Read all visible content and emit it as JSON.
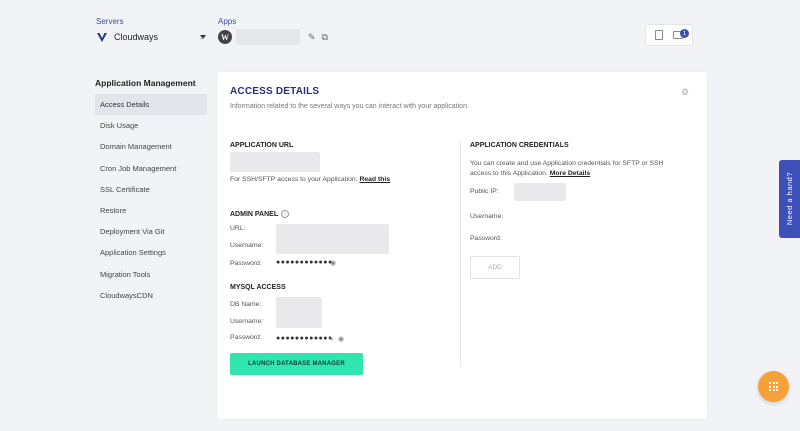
{
  "header": {
    "servers_label": "Servers",
    "server_name": "Cloudways",
    "apps_label": "Apps",
    "notification_count": "1"
  },
  "sidebar": {
    "title": "Application Management",
    "items": [
      {
        "label": "Access Details",
        "active": true
      },
      {
        "label": "Disk Usage"
      },
      {
        "label": "Domain Management"
      },
      {
        "label": "Cron Job Management"
      },
      {
        "label": "SSL Certificate"
      },
      {
        "label": "Restore"
      },
      {
        "label": "Deployment Via Git"
      },
      {
        "label": "Application Settings"
      },
      {
        "label": "Migration Tools"
      },
      {
        "label": "CloudwaysCDN"
      }
    ]
  },
  "card": {
    "title": "ACCESS DETAILS",
    "subtitle": "Information related to the several ways you can interact with your application.",
    "app_url": {
      "heading": "APPLICATION URL",
      "sftp_note": "For SSH/SFTP access to your Application.",
      "read_link": "Read this"
    },
    "admin_panel": {
      "heading": "ADMIN PANEL",
      "url_label": "URL:",
      "username_label": "Username:",
      "password_label": "Password:",
      "password_mask": "●●●●●●●●●●●●"
    },
    "mysql": {
      "heading": "MYSQL ACCESS",
      "db_label": "DB Name:",
      "username_label": "Username:",
      "password_label": "Password:",
      "password_mask": "●●●●●●●●●●●●",
      "launch_button": "LAUNCH DATABASE MANAGER"
    },
    "credentials": {
      "heading": "APPLICATION CREDENTIALS",
      "desc_line1": "You can create and use Application credentials for SFTP or SSH",
      "desc_line2": "access to this Application.",
      "more_link": "More Details",
      "public_ip_label": "Public IP:",
      "username_label": "Username:",
      "password_label": "Password:",
      "add_button": "ADD"
    }
  },
  "help_tab": "Need a hand?",
  "colors": {
    "accent": "#3d4fb8",
    "launch_button": "#2fe6b0",
    "fab": "#f6a03c"
  }
}
